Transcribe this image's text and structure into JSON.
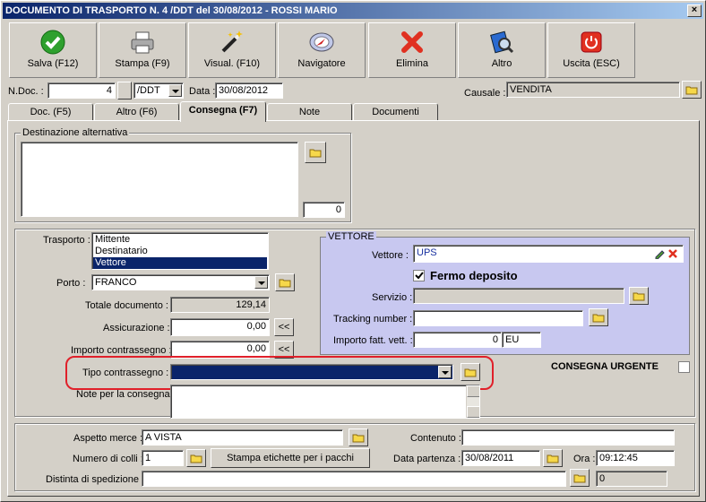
{
  "window": {
    "title": "DOCUMENTO DI TRASPORTO N. 4 /DDT del 30/08/2012 - ROSSI MARIO",
    "close": "×"
  },
  "toolbar": {
    "save": "Salva (F12)",
    "print": "Stampa (F9)",
    "view": "Visual. (F10)",
    "navigator": "Navigatore",
    "delete": "Elimina",
    "other": "Altro",
    "exit": "Uscita (ESC)"
  },
  "header": {
    "ndoc_label": "N.Doc. :",
    "ndoc_value": "4",
    "series": "/DDT",
    "date_label": "Data :",
    "date_value": "30/08/2012",
    "causale_label": "Causale :",
    "causale_value": "VENDITA"
  },
  "tabs": [
    "Doc. (F5)",
    "Altro (F6)",
    "Consegna (F7)",
    "Note",
    "Documenti"
  ],
  "destinazione": {
    "title": "Destinazione alternativa",
    "counter": "0"
  },
  "trasporto": {
    "label": "Trasporto :",
    "options": [
      "Mittente",
      "Destinatario",
      "Vettore"
    ],
    "selected": "Vettore"
  },
  "porto": {
    "label": "Porto :",
    "value": "FRANCO"
  },
  "totale": {
    "label": "Totale documento :",
    "value": "129,14"
  },
  "assicurazione": {
    "label": "Assicurazione :",
    "value": "0,00",
    "btn": "<<"
  },
  "contrassegno": {
    "label": "Importo contrassegno :",
    "value": "0,00",
    "btn": "<<"
  },
  "tipo_contrassegno": {
    "label": "Tipo contrassegno :",
    "value": ""
  },
  "note_consegna": {
    "label": "Note per la consegna"
  },
  "vettore": {
    "title": "VETTORE",
    "vettore_label": "Vettore :",
    "vettore_value": "UPS",
    "fermo": "Fermo deposito",
    "servizio_label": "Servizio :",
    "servizio_value": "",
    "tracking_label": "Tracking number :",
    "tracking_value": "",
    "importo_label": "Importo fatt. vett. :",
    "importo_value": "0",
    "currency": "EU"
  },
  "urgente": {
    "label": "CONSEGNA URGENTE"
  },
  "bottom": {
    "aspetto_label": "Aspetto merce :",
    "aspetto_value": "A VISTA",
    "contenuto_label": "Contenuto :",
    "contenuto_value": "",
    "colli_label": "Numero di colli :",
    "colli_value": "1",
    "stampa_etichette": "Stampa etichette per i pacchi",
    "partenza_label": "Data partenza :",
    "partenza_value": "30/08/2011",
    "ora_label": "Ora :",
    "ora_value": "09:12:45",
    "distinta_label": "Distinta di spedizione :",
    "distinta_value": "0"
  },
  "colors": {
    "selection": "#0a246a",
    "vettore_bg": "#c8c8f0",
    "highlight": "#e0202a"
  }
}
